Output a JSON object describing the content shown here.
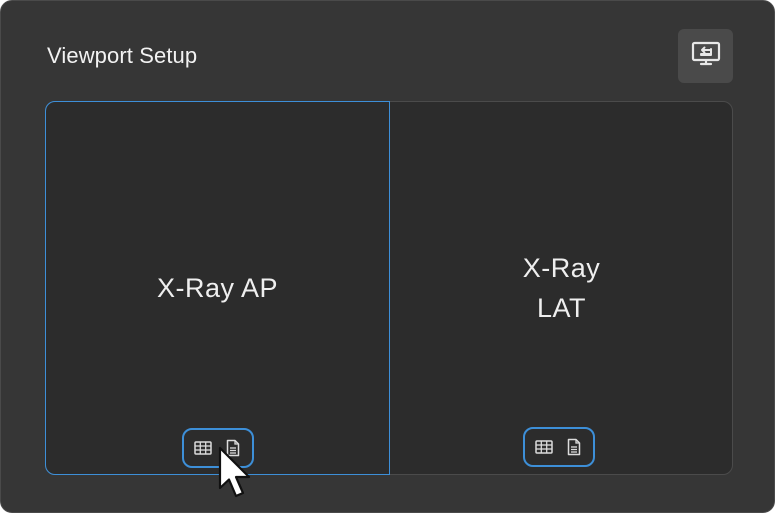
{
  "panel": {
    "title": "Viewport Setup",
    "cast_button_icon": "screen-share-icon"
  },
  "viewports": [
    {
      "label": "X-Ray AP",
      "selected": true,
      "tools": [
        "grid-layout-icon",
        "document-icon"
      ]
    },
    {
      "label_line1": "X-Ray",
      "label_line2": "LAT",
      "selected": false,
      "tools": [
        "grid-layout-icon",
        "document-icon"
      ]
    }
  ],
  "colors": {
    "panel_bg": "#363636",
    "grid_bg": "#2c2c2c",
    "accent": "#3d8fd8",
    "text": "#f2f2f2"
  }
}
